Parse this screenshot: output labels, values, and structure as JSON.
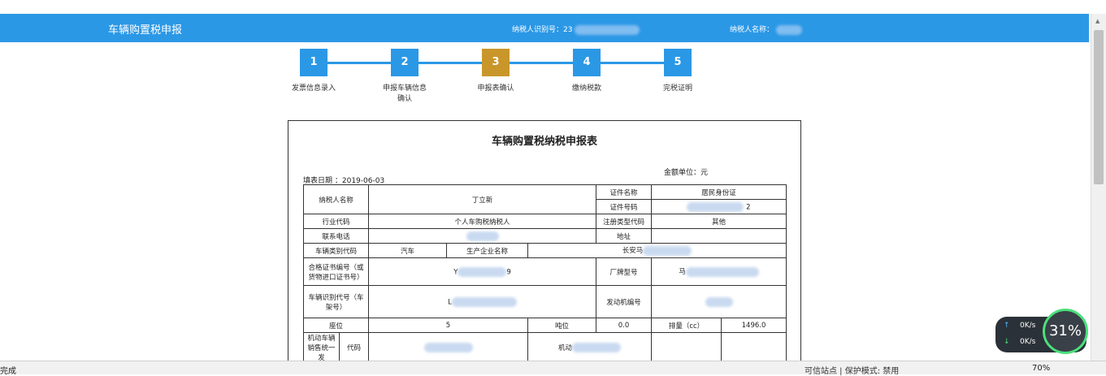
{
  "header": {
    "title": "车辆购置税申报",
    "tax_id_label": "纳税人识别号：23",
    "tax_name_label": "纳税人名称："
  },
  "steps": [
    {
      "num": "1",
      "label": "发票信息录入"
    },
    {
      "num": "2",
      "label": "申报车辆信息确认"
    },
    {
      "num": "3",
      "label": "申报表确认"
    },
    {
      "num": "4",
      "label": "缴纳税款"
    },
    {
      "num": "5",
      "label": "完税证明"
    }
  ],
  "form": {
    "title": "车辆购置税纳税申报表",
    "unit": "金额单位：元",
    "date": "填表日期 ：2019-06-03",
    "taxpayer_name_label": "纳税人名称",
    "taxpayer_name": "丁立新",
    "cert_name_label": "证件名称",
    "cert_name": "居民身份证",
    "cert_no_label": "证件号码",
    "cert_no_tail": "2",
    "industry_label": "行业代码",
    "industry": "个人车购税纳税人",
    "reg_type_label": "注册类型代码",
    "reg_type": "其他",
    "phone_label": "联系电话",
    "address_label": "地址",
    "vehicle_type_label": "车辆类别代码",
    "vehicle_type": "汽车",
    "manufacturer_label": "生产企业名称",
    "manufacturer_prefix": "长安马",
    "cert_code_label": "合格证书编号（或货物进口证书号）",
    "cert_code_prefix": "Y",
    "cert_code_tail": "9",
    "brand_label": "厂牌型号",
    "brand_prefix": "马",
    "vin_label": "车辆识别代号（车架号）",
    "vin_prefix": "L",
    "engine_label": "发动机编号",
    "seats_label": "座位",
    "seats": "5",
    "tonnage_label": "吨位",
    "tonnage": "0.0",
    "displacement_label": "排量（cc）",
    "displacement": "1496.0",
    "mv_invoice_label": "机动车辆销售统一发",
    "code_label": "代码",
    "mv_label": "机动"
  },
  "status": {
    "left": "完成",
    "mid": "可信站点 | 保护模式: 禁用",
    "zoom": "70%"
  },
  "net_widget": {
    "up": "0K/s",
    "down": "0K/s",
    "percent": "31%"
  }
}
